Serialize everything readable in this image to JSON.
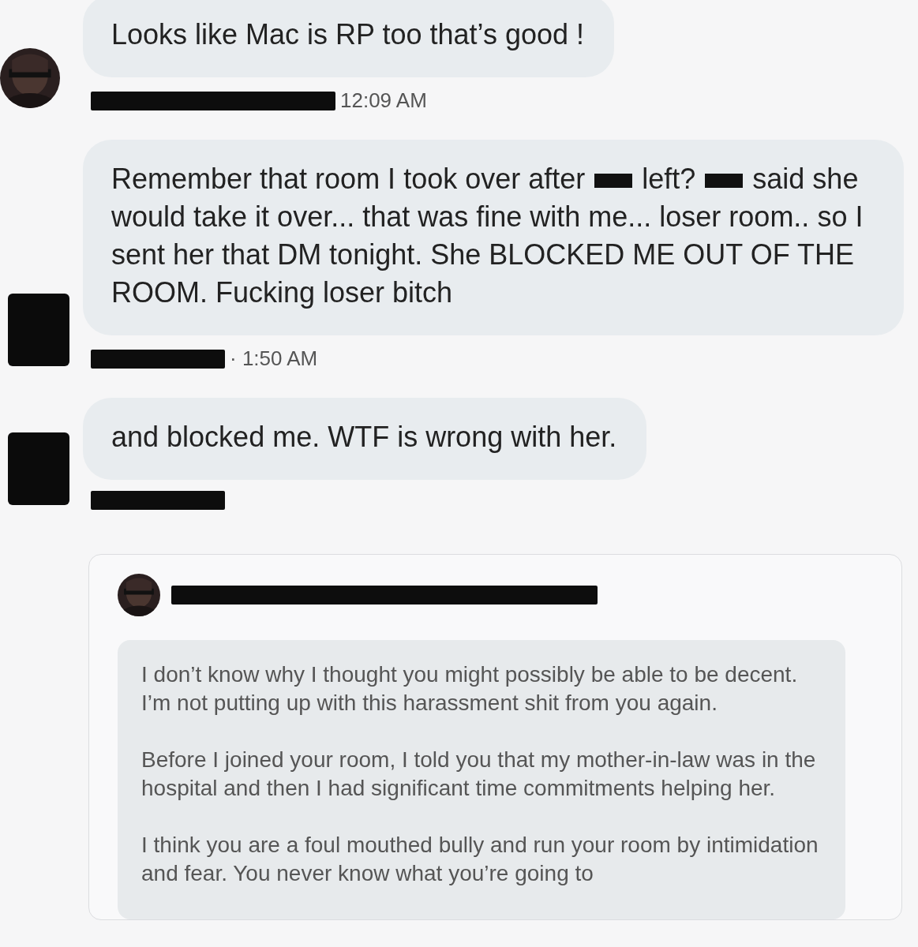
{
  "messages": [
    {
      "segments": [
        {
          "kind": "text",
          "text": "Looks like Mac is RP too that’s good !"
        }
      ],
      "meta": {
        "time": "12:09 AM"
      }
    },
    {
      "avatar": {
        "kind": "redacted"
      },
      "segments": [
        {
          "kind": "text",
          "text": "Remember that room I took over after "
        },
        {
          "kind": "redaction"
        },
        {
          "kind": "text",
          "text": " left? "
        },
        {
          "kind": "redaction"
        },
        {
          "kind": "text",
          "text": " said she would take it over... that was fine with me... loser room.. so I sent her that DM tonight. She BLOCKED ME OUT OF THE ROOM. Fucking loser bitch"
        }
      ],
      "meta": {
        "time": "· 1:50 AM"
      }
    },
    {
      "avatar": {
        "kind": "redacted"
      },
      "segments": [
        {
          "kind": "text",
          "text": "and blocked me. WTF is wrong with her."
        }
      ]
    }
  ],
  "quoted_message": {
    "paragraphs": [
      "I don’t know why I thought you might possibly be able to be decent. I’m not putting up with this harassment shit from you again.",
      "Before I joined your room, I told you that my mother-in-law was in the hospital and then I had significant time commitments helping her.",
      "I think you are a foul mouthed bully and run your room by intimidation and fear. You never know what you’re going to"
    ]
  }
}
